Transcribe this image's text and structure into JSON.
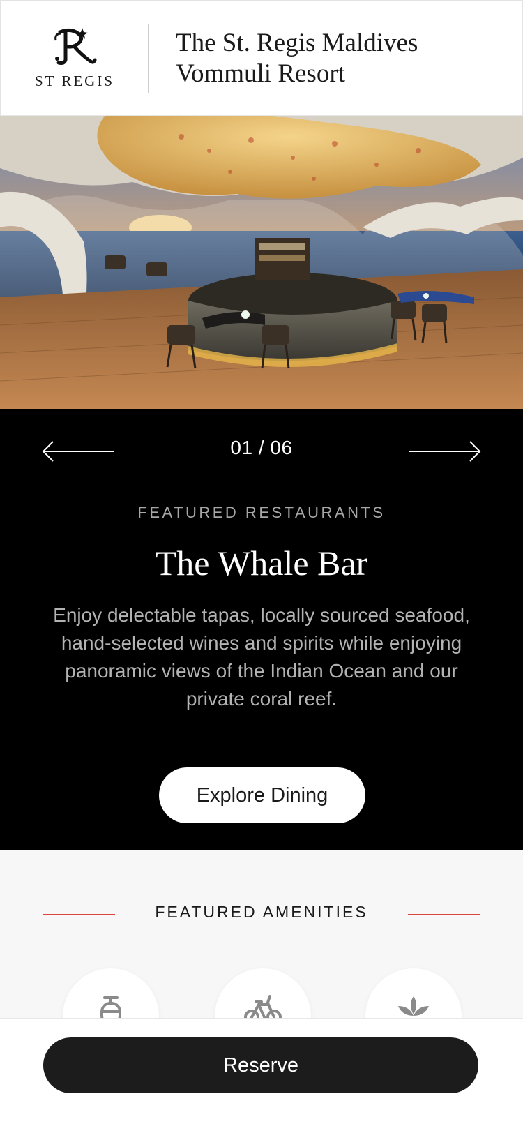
{
  "header": {
    "brand_wordmark": "ST REGIS",
    "hotel_name_line1": "The St. Regis Maldives",
    "hotel_name_line2": "Vommuli Resort"
  },
  "hero": {
    "icon": "whale-bar-photo"
  },
  "carousel": {
    "counter": "01 / 06",
    "prev_icon": "arrow-left-icon",
    "next_icon": "arrow-right-icon"
  },
  "featured_restaurant": {
    "eyebrow": "FEATURED RESTAURANTS",
    "title": "The Whale Bar",
    "description": "Enjoy delectable tapas, locally sourced seafood, hand-selected wines and spirits while enjoying panoramic views of the Indian Ocean and our private coral reef.",
    "cta_label": "Explore Dining"
  },
  "amenities": {
    "title": "FEATURED AMENITIES",
    "accent_color": "#d9463d",
    "items": [
      {
        "icon": "scuba-tank-icon"
      },
      {
        "icon": "bicycle-icon"
      },
      {
        "icon": "lotus-icon"
      }
    ]
  },
  "reserve": {
    "label": "Reserve"
  }
}
